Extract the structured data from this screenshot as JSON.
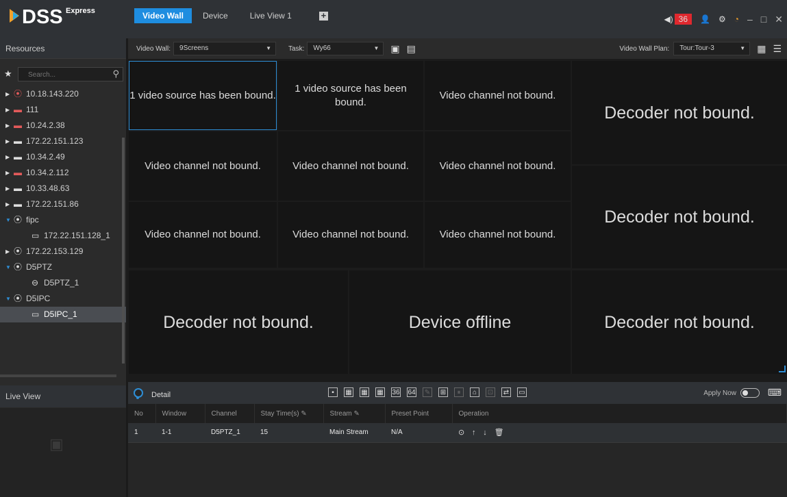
{
  "app": {
    "brand": "DSS",
    "edition": "Express"
  },
  "tabs": [
    {
      "label": "Video Wall",
      "active": true
    },
    {
      "label": "Device",
      "active": false
    },
    {
      "label": "Live View 1",
      "active": false
    }
  ],
  "titlebar": {
    "alarm_count": "36"
  },
  "sidebar": {
    "title": "Resources",
    "search_placeholder": "Search...",
    "live_view_title": "Live View",
    "tree": [
      {
        "label": "10.18.143.220",
        "icon": "camera-red-icon",
        "expanded": false
      },
      {
        "label": "111",
        "icon": "nvr-red-icon",
        "expanded": false
      },
      {
        "label": "10.24.2.38",
        "icon": "nvr-red-icon",
        "expanded": false
      },
      {
        "label": "172.22.151.123",
        "icon": "nvr-icon",
        "expanded": false
      },
      {
        "label": "10.34.2.49",
        "icon": "nvr-icon",
        "expanded": false
      },
      {
        "label": "10.34.2.112",
        "icon": "nvr-red-icon",
        "expanded": false
      },
      {
        "label": "10.33.48.63",
        "icon": "nvr-icon",
        "expanded": false
      },
      {
        "label": "172.22.151.86",
        "icon": "nvr-icon",
        "expanded": false
      },
      {
        "label": "fipc",
        "icon": "camera-icon",
        "expanded": true
      },
      {
        "label": "172.22.151.128_1",
        "icon": "ipc-channel-icon",
        "child": true
      },
      {
        "label": "172.22.153.129",
        "icon": "camera-icon",
        "expanded": false
      },
      {
        "label": "D5PTZ",
        "icon": "camera-icon",
        "expanded": true
      },
      {
        "label": "D5PTZ_1",
        "icon": "ptz-channel-icon",
        "child": true
      },
      {
        "label": "D5IPC",
        "icon": "camera-icon",
        "expanded": true
      },
      {
        "label": "D5IPC_1",
        "icon": "ipc-channel-icon",
        "child": true,
        "selected": true
      }
    ]
  },
  "toolbar": {
    "video_wall_label": "Video Wall:",
    "video_wall_value": "9Screens",
    "task_label": "Task:",
    "task_value": "Wy66",
    "plan_label": "Video Wall Plan:",
    "plan_value": "Tour:Tour-3"
  },
  "wall": {
    "cells": [
      "1 video source has been bound.",
      "1 video source has been bound.",
      "Video channel not bound.",
      "Decoder not bound.",
      "Video channel not bound.",
      "Video channel not bound.",
      "Video channel not bound.",
      "Video channel not bound.",
      "Video channel not bound.",
      "Video channel not bound.",
      "Decoder not bound.",
      "Decoder not bound.",
      "Device offline",
      "Decoder not bound."
    ]
  },
  "detail": {
    "title": "Detail",
    "apply_now": "Apply Now",
    "layout_buttons": [
      "36",
      "64"
    ],
    "columns": [
      "No",
      "Window",
      "Channel",
      "Stay Time(s)",
      "Stream",
      "Preset Point",
      "Operation"
    ],
    "rows": [
      {
        "no": "1",
        "window": "1-1",
        "channel": "D5PTZ_1",
        "stay": "15",
        "stream": "Main Stream",
        "preset": "N/A"
      }
    ]
  }
}
